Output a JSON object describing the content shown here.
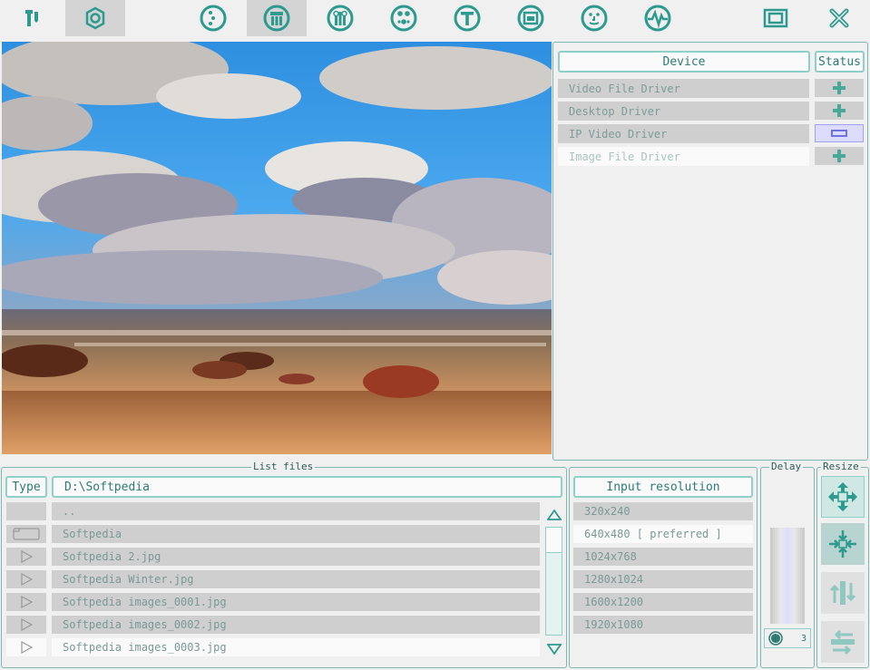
{
  "toolbar": {
    "icons": [
      "settings-wrench-icon",
      "gear-icon",
      "input-icon",
      "capture-icon",
      "filter-icon",
      "mixer-icon",
      "text-icon",
      "overlay-icon",
      "face-icon",
      "pulse-icon",
      "window-icon",
      "close-icon"
    ],
    "active": "capture-icon",
    "accent": "#2c9a8f"
  },
  "device_panel": {
    "device_header": "Device",
    "status_header": "Status",
    "devices": [
      {
        "name": "Video File Driver",
        "status": "+"
      },
      {
        "name": "Desktop Driver",
        "status": "+"
      },
      {
        "name": "IP Video Driver",
        "status": "−"
      },
      {
        "name": "Image File Driver",
        "status": "+"
      }
    ]
  },
  "list_files": {
    "title": "List files",
    "type_header": "Type",
    "path": "D:\\Softpedia",
    "files": [
      {
        "type": "",
        "name": ".."
      },
      {
        "type": "folder-icon",
        "name": "Softpedia"
      },
      {
        "type": "play-icon",
        "name": "Softpedia 2.jpg"
      },
      {
        "type": "play-icon",
        "name": "Softpedia Winter.jpg"
      },
      {
        "type": "play-icon",
        "name": "Softpedia images_0001.jpg"
      },
      {
        "type": "play-icon",
        "name": "Softpedia images_0002.jpg"
      },
      {
        "type": "play-icon",
        "name": "Softpedia images_0003.jpg"
      }
    ]
  },
  "resolution": {
    "header": "Input resolution",
    "options": [
      "320x240",
      "640x480 [ preferred ]",
      "1024x768",
      "1280x1024",
      "1600x1200",
      "1920x1080"
    ],
    "selected": "640x480 [ preferred ]"
  },
  "delay": {
    "title": "Delay",
    "value": "3"
  },
  "resize": {
    "title": "Resize",
    "buttons": [
      "move-arrows-icon",
      "shrink-center-icon",
      "vertical-arrows-icon",
      "horizontal-arrows-icon"
    ]
  },
  "colors": {
    "teal": "#2c9a8f",
    "border": "#7fb8b2",
    "row": "#cfcfcf",
    "highlight": "#dcdcff"
  }
}
